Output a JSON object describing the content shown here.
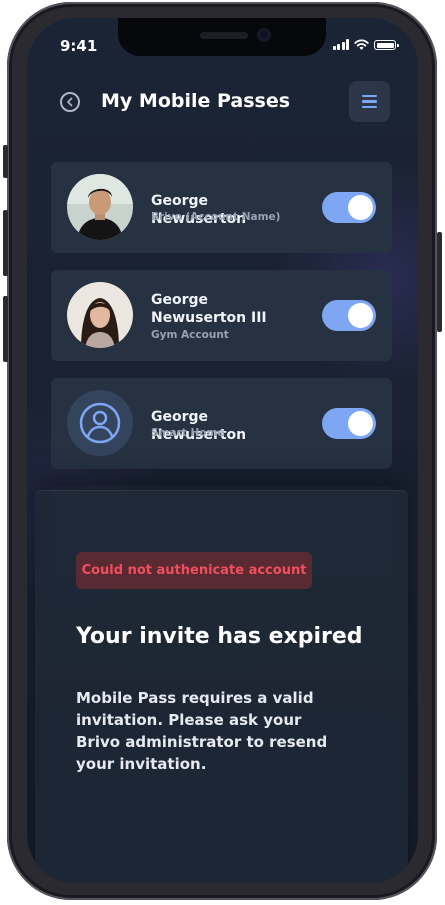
{
  "status_bar": {
    "time": "9:41"
  },
  "header": {
    "title": "My Mobile Passes"
  },
  "passes": [
    {
      "name": "George Newuserton",
      "account": "Brivo (Account Name)",
      "enabled": true,
      "avatar": "photo"
    },
    {
      "name": "George Newuserton III",
      "account": "Gym Account",
      "enabled": true,
      "avatar": "photo"
    },
    {
      "name": "George Newuserton",
      "account": "Smart Home",
      "enabled": true,
      "avatar": "user-icon"
    }
  ],
  "sheet": {
    "error": "Could not authenicate account",
    "title": "Your invite has expired",
    "body": "Mobile Pass requires a valid invitation. Please ask your Brivo administrator to resend your invitation."
  },
  "colors": {
    "accent": "#7ea6f3",
    "background": "#1a2232",
    "card": "#263142",
    "error_text": "#f04e5e",
    "error_bg": "#5a2a32"
  }
}
